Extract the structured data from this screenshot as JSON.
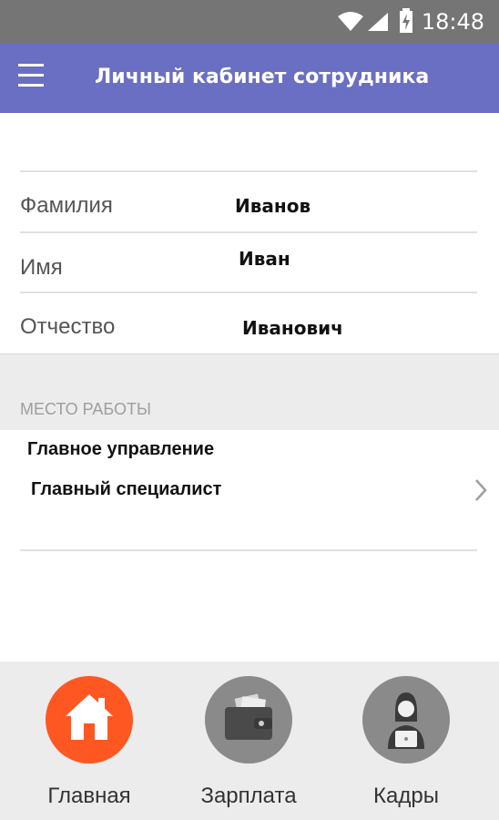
{
  "status_bar": {
    "time": "18:48",
    "icons": [
      "wifi-icon",
      "signal-icon",
      "battery-charging-icon"
    ]
  },
  "app_bar": {
    "title": "Личный кабинет сотрудника",
    "menu_icon": "hamburger-menu-icon"
  },
  "profile": {
    "fields": [
      {
        "label": "Фамилия",
        "value": "Иванов"
      },
      {
        "label": "Имя",
        "value": "Иван"
      },
      {
        "label": "Отчество",
        "value": "Иванович"
      }
    ]
  },
  "workplace": {
    "header": "МЕСТО РАБОТЫ",
    "department": "Главное управление",
    "position": "Главный специалист",
    "chevron_icon": "chevron-right-icon"
  },
  "bottom_nav": {
    "items": [
      {
        "label": "Главная",
        "icon": "home-icon",
        "active": true,
        "color": "#ff5722"
      },
      {
        "label": "Зарплата",
        "icon": "wallet-icon",
        "active": false,
        "color": "#8a8a8a"
      },
      {
        "label": "Кадры",
        "icon": "employee-icon",
        "active": false,
        "color": "#8a8a8a"
      }
    ]
  },
  "colors": {
    "app_bar": "#6a6fc4",
    "status_bar": "#757575",
    "accent": "#ff5722"
  }
}
